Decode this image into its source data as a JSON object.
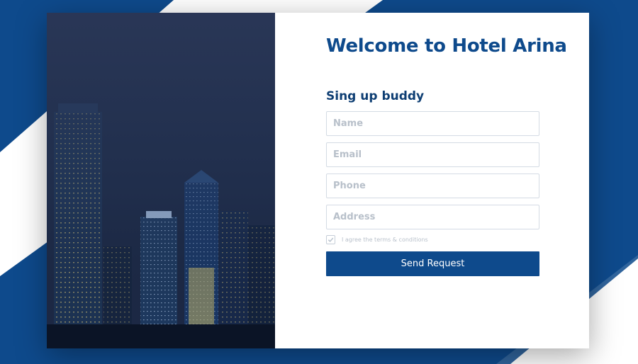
{
  "page": {
    "background_color": "#0e4a8c",
    "accent_color": "#0e4a8c",
    "card_color": "#ffffff"
  },
  "form": {
    "title": "Welcome to Hotel Arina",
    "subtitle": "Sing up buddy",
    "fields": [
      {
        "name": "name",
        "placeholder": "Name",
        "value": ""
      },
      {
        "name": "email",
        "placeholder": "Email",
        "value": ""
      },
      {
        "name": "phone",
        "placeholder": "Phone",
        "value": ""
      },
      {
        "name": "address",
        "placeholder": "Address",
        "value": ""
      }
    ],
    "agree_label": "I agree the terms & conditions",
    "agree_checked": true,
    "checkmark_icon": "check-icon",
    "submit_label": "Send Request"
  },
  "image": {
    "subject": "city-skyline-night"
  }
}
